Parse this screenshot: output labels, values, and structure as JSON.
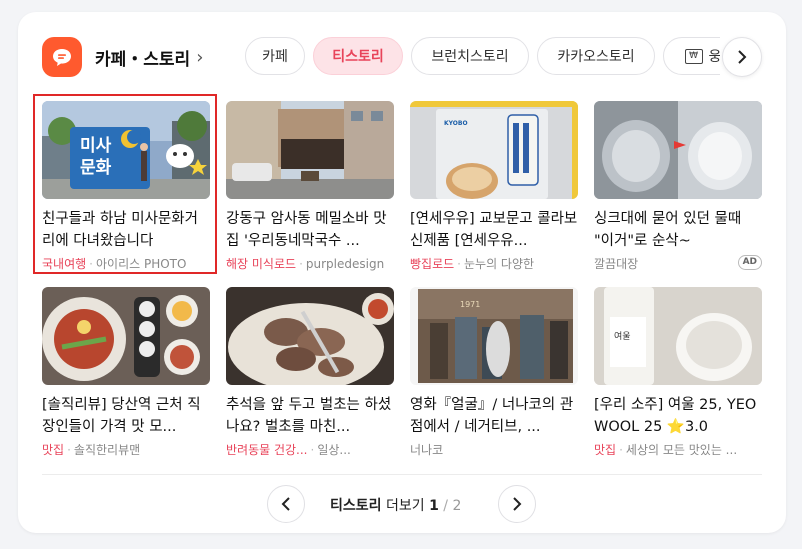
{
  "header": {
    "title": "카페・스토리",
    "logo_icon": "chat-bubble-icon",
    "brand_color": "#ff5a2e"
  },
  "tabs": [
    {
      "label": "카페",
      "active": false
    },
    {
      "label": "티스토리",
      "active": true
    },
    {
      "label": "브런치스토리",
      "active": false
    },
    {
      "label": "카카오스토리",
      "active": false
    },
    {
      "label": "웅",
      "active": false,
      "icon": "won-icon"
    }
  ],
  "items": [
    {
      "title": "친구들과 하남 미사문화거리에 다녀왔습니다",
      "category": "국내여행",
      "source": "아이리스 PHOTO",
      "ad": false,
      "selected": true
    },
    {
      "title": "강동구 암사동 메밀소바 맛집 '우리동네막국수 ...",
      "category": "해장 미식로드",
      "source": "purpledesign",
      "ad": false
    },
    {
      "title": "[연세우유] 교보문고 콜라보 신제품 [연세우유...",
      "category": "빵집로드",
      "source": "눈누의 다양한",
      "ad": false
    },
    {
      "title": "싱크대에 묻어 있던 물때 \"이거\"로 순삭~",
      "category": "",
      "source": "깔끔대장",
      "ad": true,
      "ad_label": "AD"
    },
    {
      "title": "[솔직리뷰] 당산역 근처 직장인들이 가격 맛 모...",
      "category": "맛집",
      "source": "솔직한리뷰맨",
      "ad": false
    },
    {
      "title": "추석을 앞 두고 벌초는 하셨나요? 벌초를 마친...",
      "category": "반려동물 건강...",
      "source": "일상...",
      "ad": false
    },
    {
      "title": "영화『얼굴』/ 너나코의 관점에서 / 네거티브, ...",
      "category": "",
      "source": "너나코",
      "ad": false
    },
    {
      "title": "[우리 소주] 여울 25, YEOWOOL 25 ⭐3.0",
      "category": "맛집",
      "source": "세상의 모든 맛있는 ...",
      "ad": false
    }
  ],
  "pager": {
    "label": "티스토리",
    "more": "더보기",
    "current": "1",
    "separator": "/",
    "total": "2"
  },
  "colors": {
    "accent": "#e8445a",
    "active_tab_bg": "#fde3e7"
  }
}
